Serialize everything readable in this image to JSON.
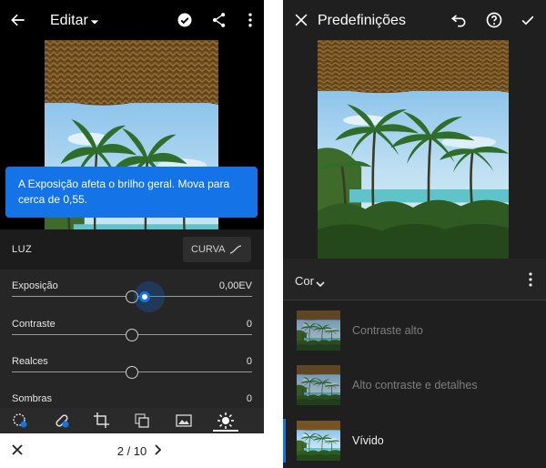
{
  "left": {
    "header": {
      "title": "Editar"
    },
    "tooltip": {
      "text": "A Exposição afeta o brilho geral. Mova para cerca de 0,55."
    },
    "section": {
      "label": "LUZ",
      "curve_button": "CURVA"
    },
    "sliders": [
      {
        "label": "Exposição",
        "value_text": "0,00EV",
        "position": 0.55
      },
      {
        "label": "Contraste",
        "value_text": "0",
        "position": 0.5
      },
      {
        "label": "Realces",
        "value_text": "0",
        "position": 0.5
      },
      {
        "label": "Sombras",
        "value_text": "0",
        "position": 0.5
      }
    ],
    "tools": [
      "auto-icon",
      "healing-icon",
      "crop-icon",
      "layers-icon",
      "image-icon",
      "light-icon"
    ],
    "pager": {
      "count": "2 / 10"
    }
  },
  "right": {
    "header": {
      "title": "Predefinições"
    },
    "category": {
      "label": "Cor"
    },
    "presets": [
      {
        "name": "Contraste alto",
        "state": "dim"
      },
      {
        "name": "Alto contraste e detalhes",
        "state": "dim"
      },
      {
        "name": "Vívido",
        "state": "active"
      }
    ]
  },
  "colors": {
    "accent": "#1473e6",
    "panel_bg": "#262626",
    "header_bg": "#000000"
  }
}
